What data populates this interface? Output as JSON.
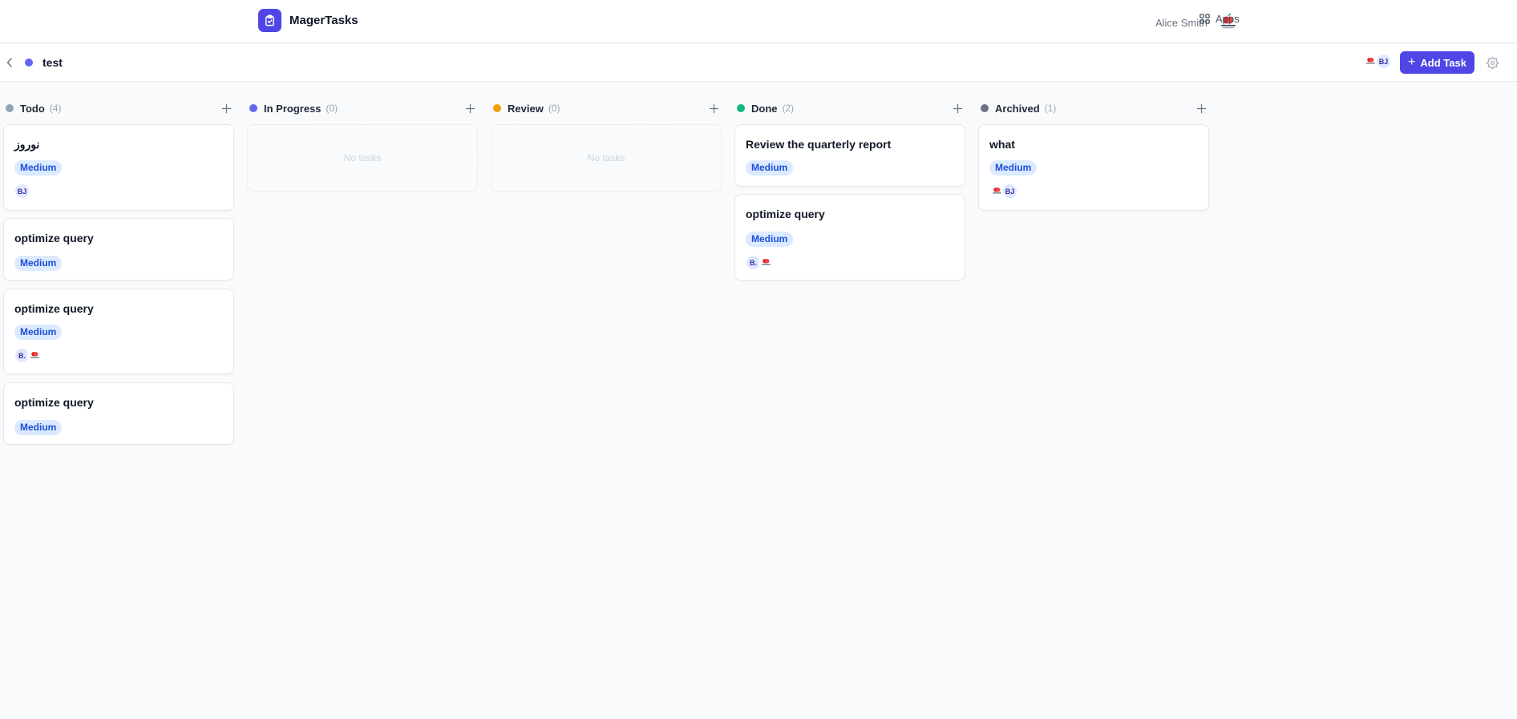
{
  "app": {
    "name": "MagerTasks",
    "brand_color": "#4f46e5"
  },
  "topbar": {
    "user_name": "Alice Smith",
    "user_avatar_icon": "red-apple-logo-icon",
    "apps_label": "Apps",
    "apps_icon": "grid-icon"
  },
  "board": {
    "project_name": "test",
    "project_color": "#6366f1",
    "members": [
      "apple-logo-avatar",
      "BJ"
    ],
    "add_task_label": "Add Task"
  },
  "columns": [
    {
      "title": "Todo",
      "count": "(4)",
      "color": "#94a3b8",
      "cards": [
        {
          "title": "نوروز",
          "priority": "Medium",
          "assignees": [
            "BJ"
          ]
        },
        {
          "title": "optimize query",
          "priority": "Medium",
          "assignees": []
        },
        {
          "title": "optimize query",
          "priority": "Medium",
          "assignees": [
            "B.",
            "apple-logo-avatar"
          ]
        },
        {
          "title": "optimize query",
          "priority": "Medium",
          "assignees": []
        }
      ]
    },
    {
      "title": "In Progress",
      "count": "(0)",
      "color": "#6366f1",
      "empty_label": "No tasks",
      "cards": []
    },
    {
      "title": "Review",
      "count": "(0)",
      "color": "#f59e0b",
      "empty_label": "No tasks",
      "cards": []
    },
    {
      "title": "Done",
      "count": "(2)",
      "color": "#10b981",
      "cards": [
        {
          "title": "Review the quarterly report",
          "priority": "Medium",
          "assignees": []
        },
        {
          "title": "optimize query",
          "priority": "Medium",
          "assignees": [
            "B.",
            "apple-logo-avatar"
          ]
        }
      ]
    },
    {
      "title": "Archived",
      "count": "(1)",
      "color": "#6b7280",
      "cards": [
        {
          "title": "what",
          "priority": "Medium",
          "assignees": [
            "apple-logo-avatar",
            "BJ"
          ]
        }
      ]
    }
  ],
  "colors": {
    "badge_bg": "#dbeafe",
    "badge_text": "#1d4ed8"
  }
}
